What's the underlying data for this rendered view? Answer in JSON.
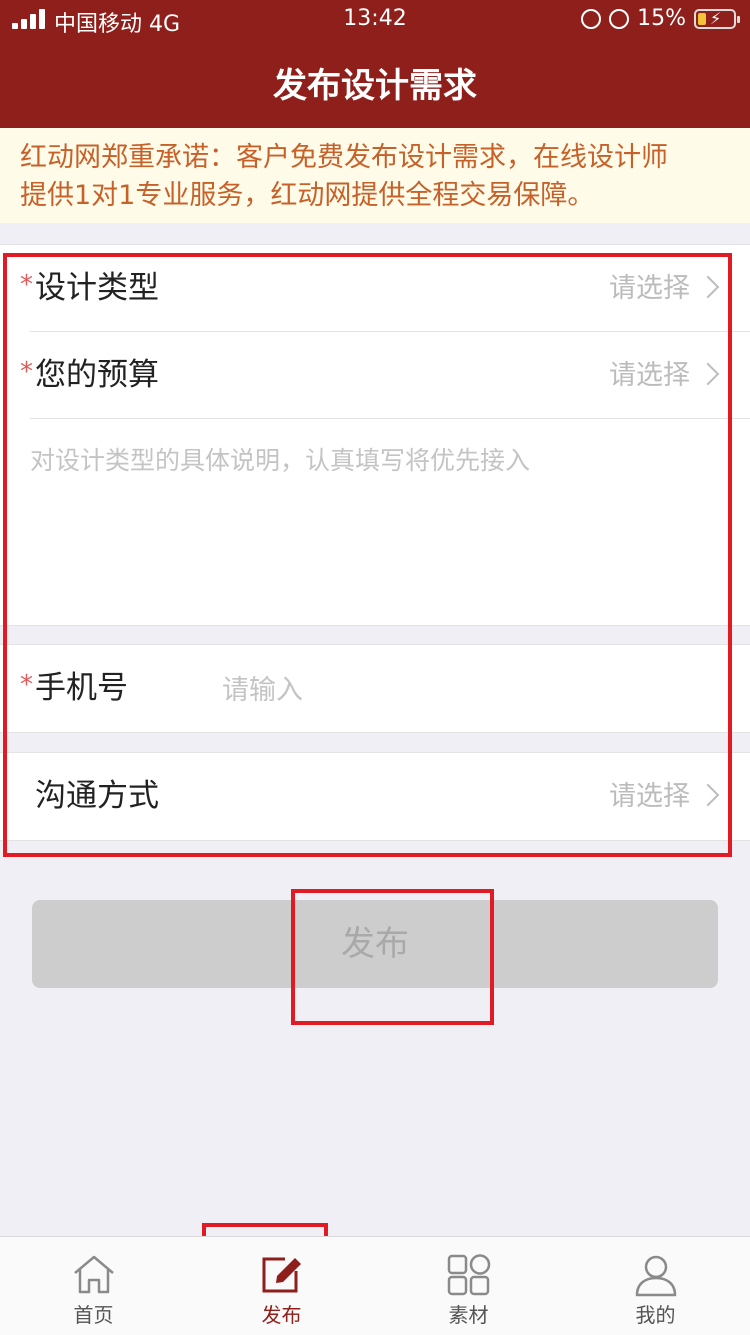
{
  "status_bar": {
    "carrier": "中国移动",
    "network": "4G",
    "time": "13:42",
    "battery": "15%"
  },
  "nav": {
    "title": "发布设计需求"
  },
  "notice": {
    "line1": "红动网郑重承诺：客户免费发布设计需求，在线设计师",
    "line2": "提供1对1专业服务，红动网提供全程交易保障。"
  },
  "form": {
    "required_mark": "*",
    "design_type": {
      "label": "设计类型",
      "value": "请选择"
    },
    "budget": {
      "label": "您的预算",
      "value": "请选择"
    },
    "description": {
      "placeholder": "对设计类型的具体说明，认真填写将优先接入"
    },
    "phone": {
      "label": "手机号",
      "placeholder": "请输入"
    },
    "contact": {
      "label": "沟通方式",
      "value": "请选择"
    },
    "submit_label": "发布"
  },
  "tabbar": {
    "items": [
      {
        "label": "首页",
        "icon": "home-icon"
      },
      {
        "label": "发布",
        "icon": "edit-icon",
        "active": true
      },
      {
        "label": "素材",
        "icon": "grid-icon"
      },
      {
        "label": "我的",
        "icon": "user-icon"
      }
    ]
  },
  "colors": {
    "brand": "#8e1f1a",
    "notice_text": "#c7612a",
    "annotation": "#e11b23"
  }
}
